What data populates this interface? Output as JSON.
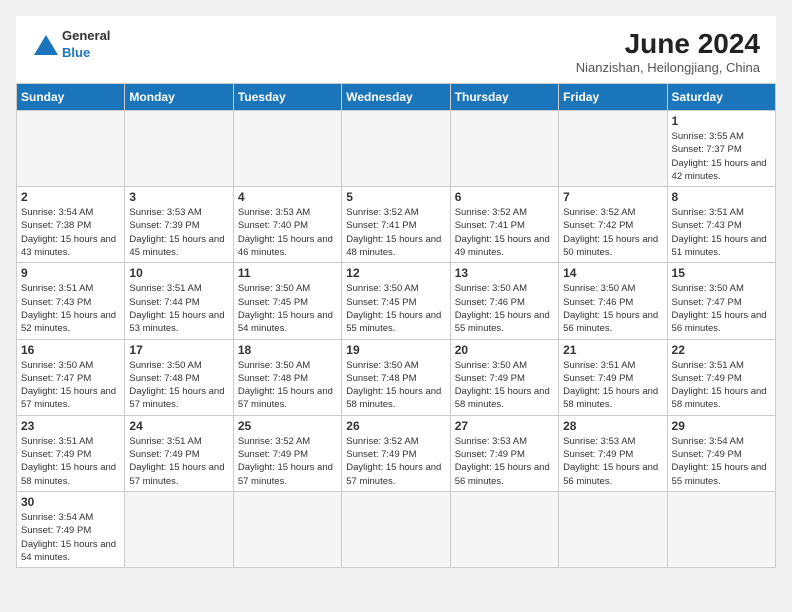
{
  "header": {
    "logo_general": "General",
    "logo_blue": "Blue",
    "month_year": "June 2024",
    "location": "Nianzishan, Heilongjiang, China"
  },
  "days_of_week": [
    "Sunday",
    "Monday",
    "Tuesday",
    "Wednesday",
    "Thursday",
    "Friday",
    "Saturday"
  ],
  "weeks": [
    [
      {
        "day": "",
        "info": ""
      },
      {
        "day": "",
        "info": ""
      },
      {
        "day": "",
        "info": ""
      },
      {
        "day": "",
        "info": ""
      },
      {
        "day": "",
        "info": ""
      },
      {
        "day": "",
        "info": ""
      },
      {
        "day": "1",
        "info": "Sunrise: 3:55 AM\nSunset: 7:37 PM\nDaylight: 15 hours\nand 42 minutes."
      }
    ],
    [
      {
        "day": "2",
        "info": "Sunrise: 3:54 AM\nSunset: 7:38 PM\nDaylight: 15 hours\nand 43 minutes."
      },
      {
        "day": "3",
        "info": "Sunrise: 3:53 AM\nSunset: 7:39 PM\nDaylight: 15 hours\nand 45 minutes."
      },
      {
        "day": "4",
        "info": "Sunrise: 3:53 AM\nSunset: 7:40 PM\nDaylight: 15 hours\nand 46 minutes."
      },
      {
        "day": "5",
        "info": "Sunrise: 3:52 AM\nSunset: 7:41 PM\nDaylight: 15 hours\nand 48 minutes."
      },
      {
        "day": "6",
        "info": "Sunrise: 3:52 AM\nSunset: 7:41 PM\nDaylight: 15 hours\nand 49 minutes."
      },
      {
        "day": "7",
        "info": "Sunrise: 3:52 AM\nSunset: 7:42 PM\nDaylight: 15 hours\nand 50 minutes."
      },
      {
        "day": "8",
        "info": "Sunrise: 3:51 AM\nSunset: 7:43 PM\nDaylight: 15 hours\nand 51 minutes."
      }
    ],
    [
      {
        "day": "9",
        "info": "Sunrise: 3:51 AM\nSunset: 7:43 PM\nDaylight: 15 hours\nand 52 minutes."
      },
      {
        "day": "10",
        "info": "Sunrise: 3:51 AM\nSunset: 7:44 PM\nDaylight: 15 hours\nand 53 minutes."
      },
      {
        "day": "11",
        "info": "Sunrise: 3:50 AM\nSunset: 7:45 PM\nDaylight: 15 hours\nand 54 minutes."
      },
      {
        "day": "12",
        "info": "Sunrise: 3:50 AM\nSunset: 7:45 PM\nDaylight: 15 hours\nand 55 minutes."
      },
      {
        "day": "13",
        "info": "Sunrise: 3:50 AM\nSunset: 7:46 PM\nDaylight: 15 hours\nand 55 minutes."
      },
      {
        "day": "14",
        "info": "Sunrise: 3:50 AM\nSunset: 7:46 PM\nDaylight: 15 hours\nand 56 minutes."
      },
      {
        "day": "15",
        "info": "Sunrise: 3:50 AM\nSunset: 7:47 PM\nDaylight: 15 hours\nand 56 minutes."
      }
    ],
    [
      {
        "day": "16",
        "info": "Sunrise: 3:50 AM\nSunset: 7:47 PM\nDaylight: 15 hours\nand 57 minutes."
      },
      {
        "day": "17",
        "info": "Sunrise: 3:50 AM\nSunset: 7:48 PM\nDaylight: 15 hours\nand 57 minutes."
      },
      {
        "day": "18",
        "info": "Sunrise: 3:50 AM\nSunset: 7:48 PM\nDaylight: 15 hours\nand 57 minutes."
      },
      {
        "day": "19",
        "info": "Sunrise: 3:50 AM\nSunset: 7:48 PM\nDaylight: 15 hours\nand 58 minutes."
      },
      {
        "day": "20",
        "info": "Sunrise: 3:50 AM\nSunset: 7:49 PM\nDaylight: 15 hours\nand 58 minutes."
      },
      {
        "day": "21",
        "info": "Sunrise: 3:51 AM\nSunset: 7:49 PM\nDaylight: 15 hours\nand 58 minutes."
      },
      {
        "day": "22",
        "info": "Sunrise: 3:51 AM\nSunset: 7:49 PM\nDaylight: 15 hours\nand 58 minutes."
      }
    ],
    [
      {
        "day": "23",
        "info": "Sunrise: 3:51 AM\nSunset: 7:49 PM\nDaylight: 15 hours\nand 58 minutes."
      },
      {
        "day": "24",
        "info": "Sunrise: 3:51 AM\nSunset: 7:49 PM\nDaylight: 15 hours\nand 57 minutes."
      },
      {
        "day": "25",
        "info": "Sunrise: 3:52 AM\nSunset: 7:49 PM\nDaylight: 15 hours\nand 57 minutes."
      },
      {
        "day": "26",
        "info": "Sunrise: 3:52 AM\nSunset: 7:49 PM\nDaylight: 15 hours\nand 57 minutes."
      },
      {
        "day": "27",
        "info": "Sunrise: 3:53 AM\nSunset: 7:49 PM\nDaylight: 15 hours\nand 56 minutes."
      },
      {
        "day": "28",
        "info": "Sunrise: 3:53 AM\nSunset: 7:49 PM\nDaylight: 15 hours\nand 56 minutes."
      },
      {
        "day": "29",
        "info": "Sunrise: 3:54 AM\nSunset: 7:49 PM\nDaylight: 15 hours\nand 55 minutes."
      }
    ],
    [
      {
        "day": "30",
        "info": "Sunrise: 3:54 AM\nSunset: 7:49 PM\nDaylight: 15 hours\nand 54 minutes."
      },
      {
        "day": "",
        "info": ""
      },
      {
        "day": "",
        "info": ""
      },
      {
        "day": "",
        "info": ""
      },
      {
        "day": "",
        "info": ""
      },
      {
        "day": "",
        "info": ""
      },
      {
        "day": "",
        "info": ""
      }
    ]
  ]
}
